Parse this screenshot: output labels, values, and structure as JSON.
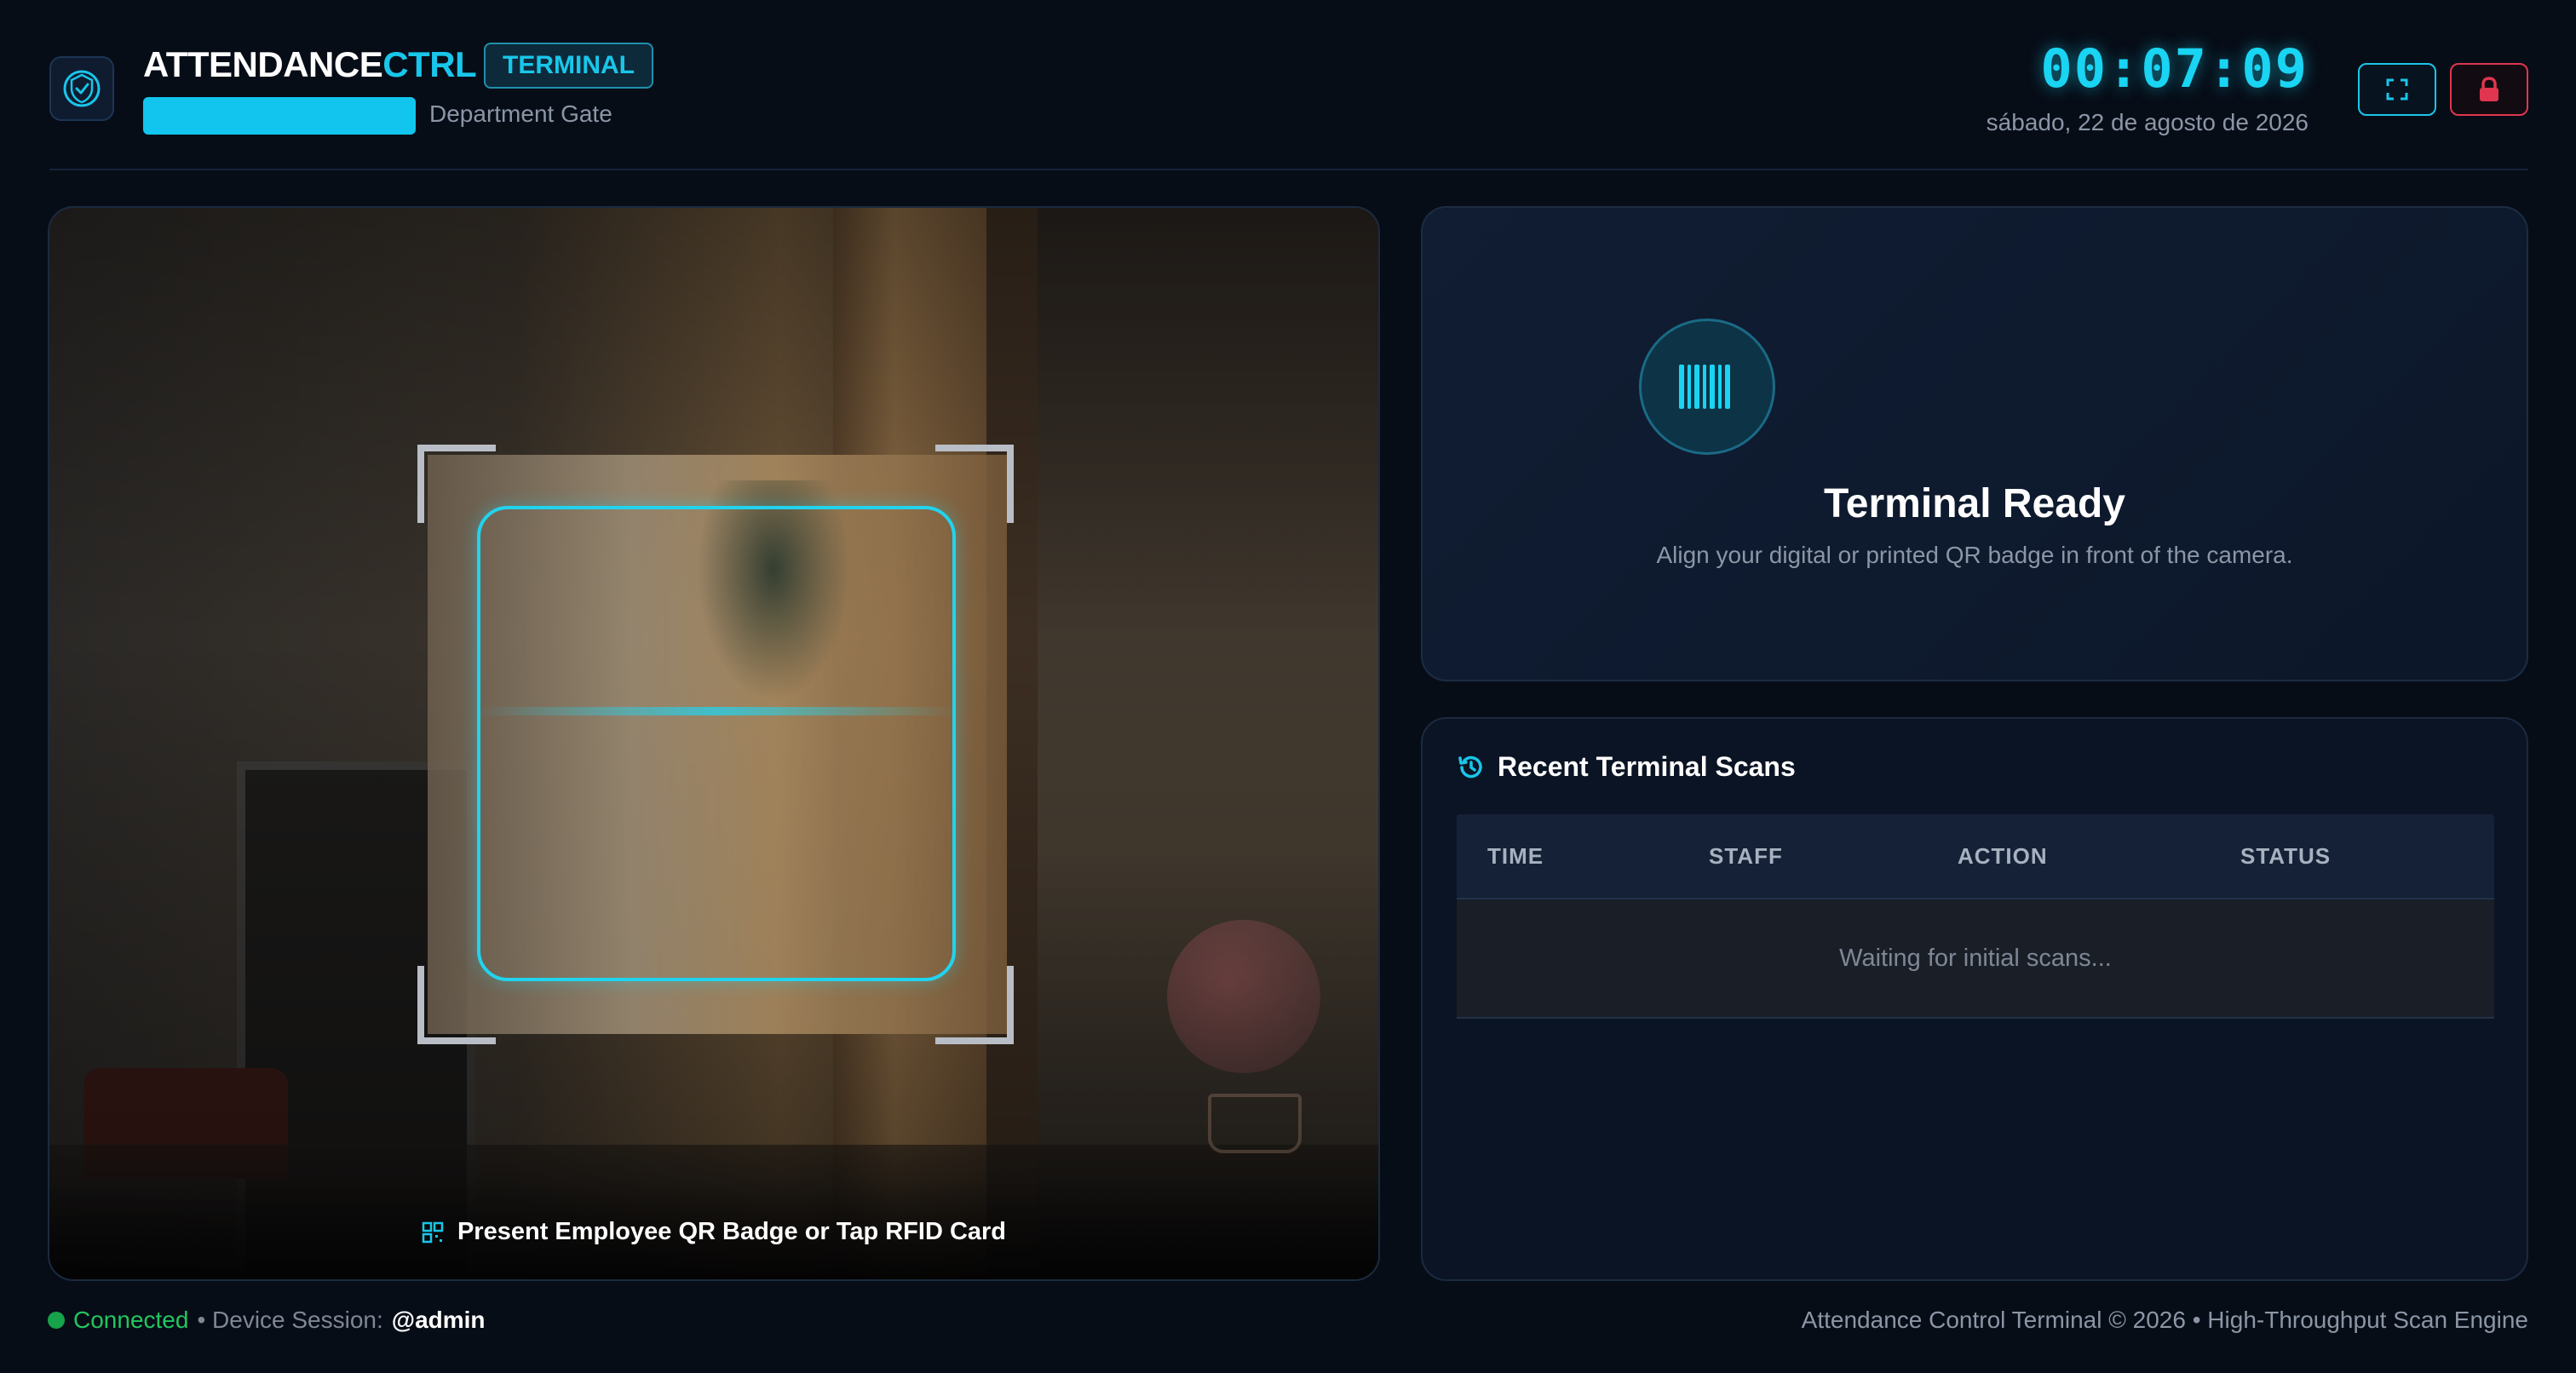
{
  "header": {
    "brand_main": "ATTENDANCE",
    "brand_accent": "CTRL",
    "badge": "TERMINAL",
    "gate_label": "Department Gate",
    "clock": "00:07:09",
    "date": "sábado, 22 de agosto de 2026",
    "icons": {
      "logo": "shield-check-icon",
      "fullscreen": "fullscreen-icon",
      "lock": "lock-icon"
    }
  },
  "camera": {
    "instruction": "Present Employee QR Badge or Tap RFID Card",
    "instruction_icon": "qr-code-icon"
  },
  "status": {
    "title": "Terminal Ready",
    "subtitle": "Align your digital or printed QR badge in front of the camera.",
    "icon": "barcode-icon"
  },
  "recent": {
    "title": "Recent Terminal Scans",
    "icon": "history-icon",
    "columns": [
      "TIME",
      "STAFF",
      "ACTION",
      "STATUS"
    ],
    "empty_message": "Waiting for initial scans..."
  },
  "footer": {
    "connection": "Connected",
    "session_prefix": "• Device Session:",
    "session_user": "@admin",
    "copyright": "Attendance Control Terminal © 2026 • High-Throughput Scan Engine"
  },
  "colors": {
    "accent": "#19c6ea",
    "danger": "#e0364f",
    "success": "#22c55e",
    "background": "#070d17"
  }
}
